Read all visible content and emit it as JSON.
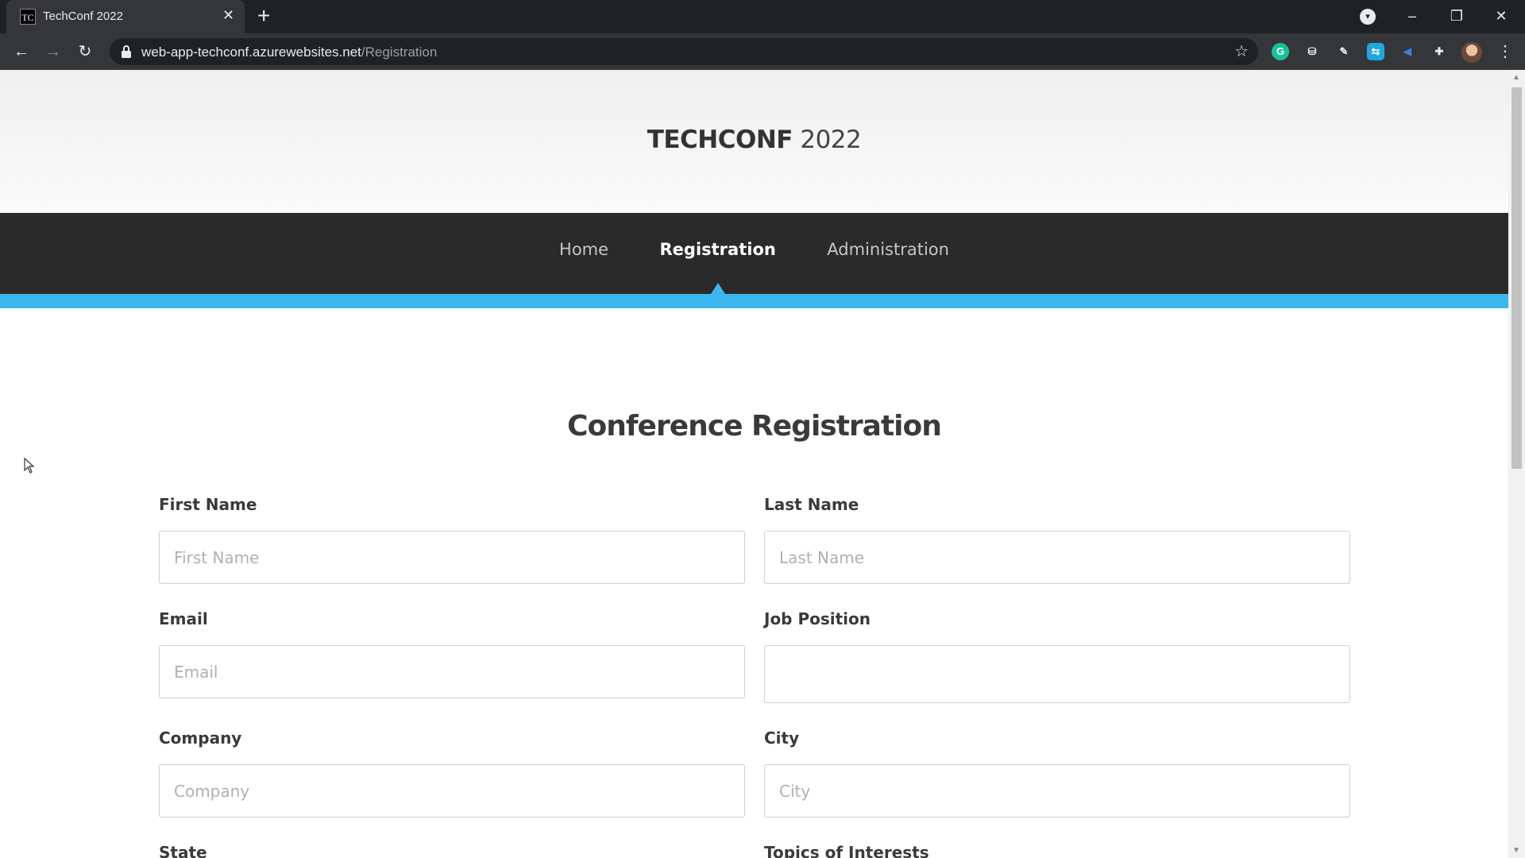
{
  "browser": {
    "tab_title": "TechConf 2022",
    "favicon_text": "TC",
    "url_host": "web-app-techconf.azurewebsites.net",
    "url_path": "/Registration"
  },
  "site": {
    "brand_bold": "TECHCONF",
    "brand_year": "2022",
    "nav": [
      {
        "label": "Home",
        "active": false
      },
      {
        "label": "Registration",
        "active": true
      },
      {
        "label": "Administration",
        "active": false
      }
    ],
    "accent_color": "#3bb7ef"
  },
  "form": {
    "heading": "Conference Registration",
    "first_name": {
      "label": "First Name",
      "placeholder": "First Name"
    },
    "last_name": {
      "label": "Last Name",
      "placeholder": "Last Name"
    },
    "email": {
      "label": "Email",
      "placeholder": "Email"
    },
    "job_position": {
      "label": "Job Position",
      "placeholder": ""
    },
    "company": {
      "label": "Company",
      "placeholder": "Company"
    },
    "city": {
      "label": "City",
      "placeholder": "City"
    },
    "state": {
      "label": "State"
    },
    "topics": {
      "label": "Topics of Interests"
    }
  }
}
